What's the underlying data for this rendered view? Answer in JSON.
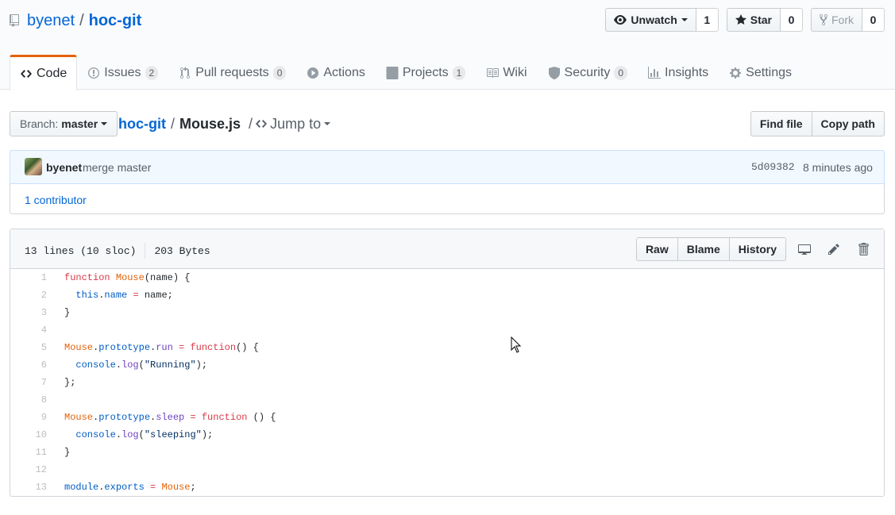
{
  "repo": {
    "owner": "byenet",
    "separator": "/",
    "name": "hoc-git"
  },
  "actions": {
    "watch": {
      "label": "Unwatch",
      "count": "1"
    },
    "star": {
      "label": "Star",
      "count": "0"
    },
    "fork": {
      "label": "Fork",
      "count": "0"
    }
  },
  "nav": {
    "items": [
      {
        "label": "Code",
        "counter": "",
        "icon": "code-icon"
      },
      {
        "label": "Issues",
        "counter": "2",
        "icon": "issue-icon"
      },
      {
        "label": "Pull requests",
        "counter": "0",
        "icon": "pull-request-icon"
      },
      {
        "label": "Actions",
        "counter": "",
        "icon": "play-icon"
      },
      {
        "label": "Projects",
        "counter": "1",
        "icon": "project-icon"
      },
      {
        "label": "Wiki",
        "counter": "",
        "icon": "book-icon"
      },
      {
        "label": "Security",
        "counter": "0",
        "icon": "shield-icon"
      },
      {
        "label": "Insights",
        "counter": "",
        "icon": "graph-icon"
      },
      {
        "label": "Settings",
        "counter": "",
        "icon": "gear-icon"
      }
    ]
  },
  "file_nav": {
    "branch_label": "Branch:",
    "branch": "master",
    "crumb_repo": "hoc-git",
    "crumb_sep": "/",
    "crumb_file": "Mouse.js",
    "jump_sep": "/",
    "jump_label": "Jump to",
    "find_file": "Find file",
    "copy_path": "Copy path"
  },
  "commit": {
    "author": "byenet",
    "message": "merge master",
    "sha": "5d09382",
    "time": "8 minutes ago",
    "contributors": "1 contributor"
  },
  "file": {
    "lines_info": "13 lines (10 sloc)",
    "size": "203 Bytes",
    "raw": "Raw",
    "blame": "Blame",
    "history": "History"
  },
  "code_lines": [
    {
      "n": "1",
      "html": "<span class=\"k\">function</span> <span class=\"v\">Mouse</span>(name) {"
    },
    {
      "n": "2",
      "html": "  <span class=\"c1\">this</span>.<span class=\"c1\">name</span> <span class=\"k\">=</span> name;"
    },
    {
      "n": "3",
      "html": "}"
    },
    {
      "n": "4",
      "html": ""
    },
    {
      "n": "5",
      "html": "<span class=\"v\">Mouse</span>.<span class=\"c1\">prototype</span>.<span class=\"en\">run</span> <span class=\"k\">=</span> <span class=\"k\">function</span>() {"
    },
    {
      "n": "6",
      "html": "  <span class=\"c1\">console</span>.<span class=\"en\">log</span>(<span class=\"s\">\"Running\"</span>);"
    },
    {
      "n": "7",
      "html": "};"
    },
    {
      "n": "8",
      "html": ""
    },
    {
      "n": "9",
      "html": "<span class=\"v\">Mouse</span>.<span class=\"c1\">prototype</span>.<span class=\"en\">sleep</span> <span class=\"k\">=</span> <span class=\"k\">function</span> () {"
    },
    {
      "n": "10",
      "html": "  <span class=\"c1\">console</span>.<span class=\"en\">log</span>(<span class=\"s\">\"sleeping\"</span>);"
    },
    {
      "n": "11",
      "html": "}"
    },
    {
      "n": "12",
      "html": ""
    },
    {
      "n": "13",
      "html": "<span class=\"c1\">module</span>.<span class=\"c1\">exports</span> <span class=\"k\">=</span> <span class=\"v\">Mouse</span>;"
    }
  ],
  "colors": {
    "link": "#0366d6",
    "accent": "#e36209",
    "keyword": "#d73a49",
    "function": "#6f42c1",
    "constant": "#005cc5",
    "string": "#032f62"
  }
}
